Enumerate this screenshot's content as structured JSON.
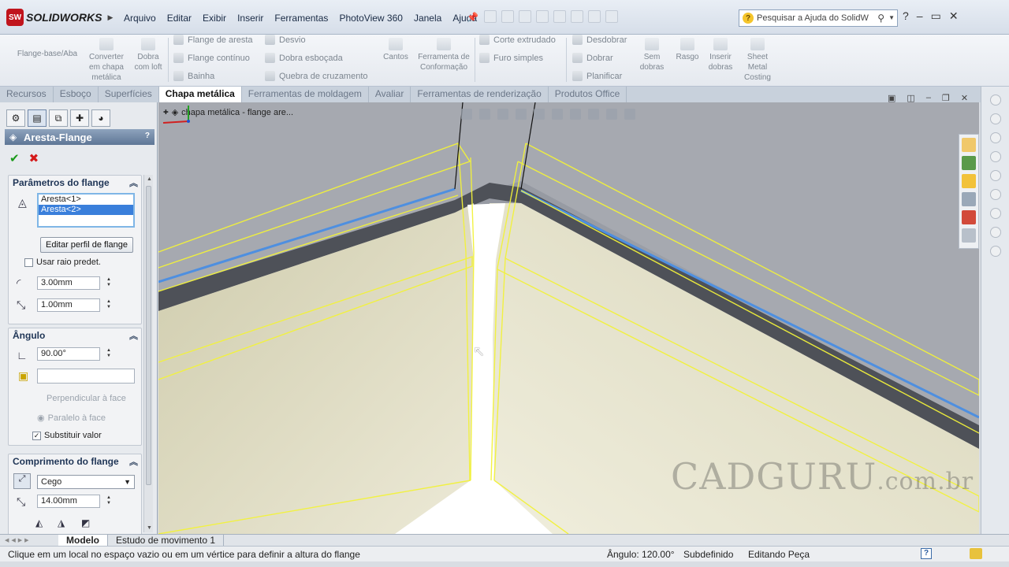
{
  "app": {
    "logo_mark": "SW",
    "name": "SOLIDWORKS"
  },
  "menu": [
    "Arquivo",
    "Editar",
    "Exibir",
    "Inserir",
    "Ferramentas",
    "PhotoView 360",
    "Janela",
    "Ajuda"
  ],
  "search": {
    "placeholder": "Pesquisar a Ajuda do SolidW"
  },
  "window_controls": {
    "help": "?",
    "minimize": "–",
    "restore": "▭",
    "close": "✕"
  },
  "commands": {
    "flange_base": "Flange-base/Aba",
    "converter": "Converter em chapa metálica",
    "dobra_loft": "Dobra com loft",
    "flange_aresta": "Flange de aresta",
    "flange_continuo": "Flange contínuo",
    "bainha": "Bainha",
    "desvio": "Desvio",
    "dobra_esbocada": "Dobra esboçada",
    "quebra": "Quebra de cruzamento",
    "cantos": "Cantos",
    "ferramenta": "Ferramenta de Conformação",
    "corte": "Corte extrudado",
    "furo": "Furo simples",
    "desdobrar": "Desdobrar",
    "dobrar": "Dobrar",
    "planificar": "Planificar",
    "sem_dobras": "Sem dobras",
    "rasgo": "Rasgo",
    "inserir_dobras": "Inserir dobras",
    "sheet_metal_costing": "Sheet Metal Costing"
  },
  "tabs": [
    "Recursos",
    "Esboço",
    "Superfícies",
    "Chapa metálica",
    "Ferramentas de moldagem",
    "Avaliar",
    "Ferramentas de renderização",
    "Produtos Office"
  ],
  "pm": {
    "title": "Aresta-Flange",
    "help": "?",
    "ok": "✔",
    "cancel": "✖",
    "params_title": "Parâmetros do flange",
    "edges": [
      "Aresta<1>",
      "Aresta<2>"
    ],
    "edit_profile": "Editar perfil de flange",
    "use_default_radius": "Usar raio predet.",
    "radius": "3.00mm",
    "gap": "1.00mm",
    "angle_title": "Ângulo",
    "angle": "90.00°",
    "angle_ref": "",
    "perpendicular": "Perpendicular à face",
    "parallel": "Paralelo à face",
    "substituir": "Substituir valor",
    "length_title": "Comprimento do flange",
    "end_condition": "Cego",
    "length": "14.00mm"
  },
  "viewport": {
    "tree_path": "chapa metálica - flange are...",
    "watermark": "CADGURU",
    "watermark_suffix": ".com.br"
  },
  "bottom_tabs": [
    "Modelo",
    "Estudo de movimento 1"
  ],
  "status": {
    "message": "Clique em um local no espaço vazio ou em um vértice para definir a altura do flange",
    "angle": "Ângulo: 120.00°",
    "definition": "Subdefinido",
    "mode": "Editando Peça",
    "help": "?"
  },
  "colors": {
    "preview_yellow": "#f2f23a",
    "edge_blue": "#4e8fe0",
    "part_face": "#e8e6cf",
    "part_top": "#a8aab0",
    "selection_blue": "#3a7fdb"
  }
}
